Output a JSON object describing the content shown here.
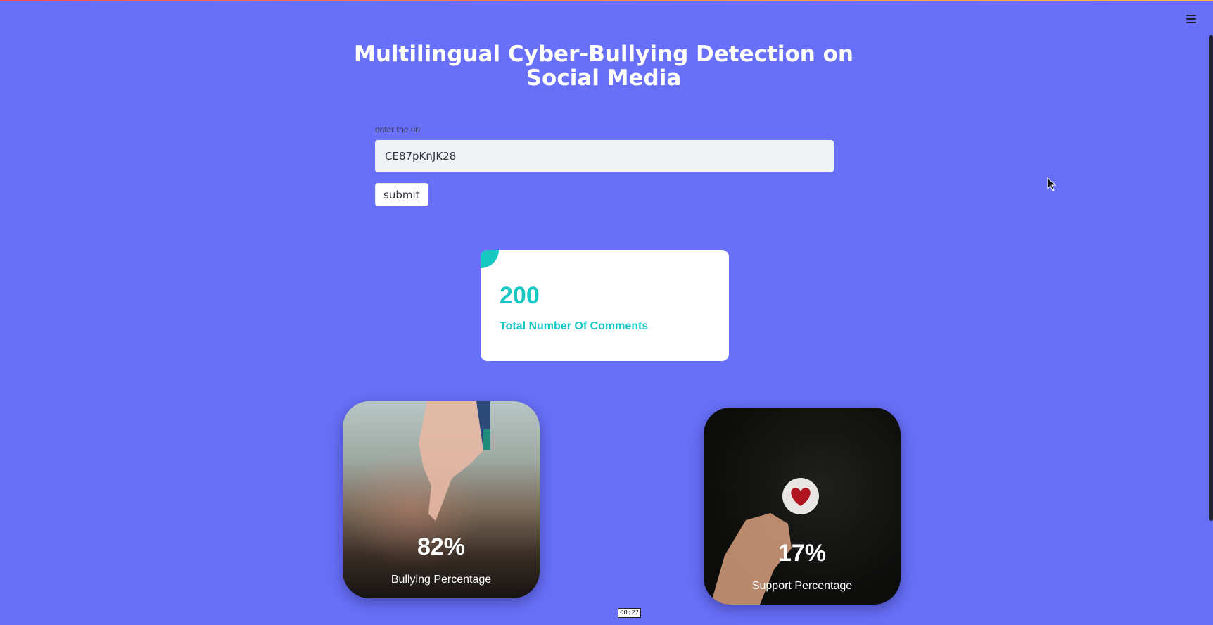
{
  "header": {
    "title": "Multilingual Cyber-Bullying Detection on Social Media",
    "menu_icon": "hamburger-icon"
  },
  "form": {
    "url_label": "enter the url",
    "url_value": "CE87pKnJK28",
    "submit_label": "submit"
  },
  "summary": {
    "total_comments": "200",
    "total_comments_label": "Total Number Of Comments",
    "accent_color": "#15c8c2"
  },
  "cards": {
    "bullying": {
      "value": "82%",
      "label": "Bullying Percentage",
      "icon": "thumbs-down-photo"
    },
    "support": {
      "value": "17%",
      "label": "Support Percentage",
      "icon": "heart-photo"
    }
  },
  "overlay": {
    "timer": "00:27"
  },
  "colors": {
    "background": "#6870f9",
    "card": "#ffffff"
  }
}
